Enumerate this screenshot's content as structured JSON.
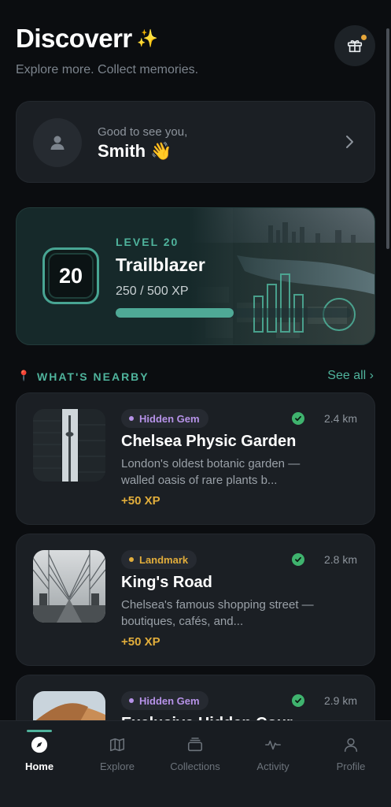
{
  "app": {
    "title": "Discoverr",
    "subtitle": "Explore more. Collect memories."
  },
  "greeting": {
    "prefix": "Good to see you,",
    "name": "Smith",
    "emoji": "👋"
  },
  "level": {
    "label": "LEVEL 20",
    "number": "20",
    "title": "Trailblazer",
    "xp_text": "250 / 500 XP",
    "progress": 0.5
  },
  "nearby": {
    "label": "WHAT'S NEARBY",
    "see_all": "See all ›"
  },
  "places": [
    {
      "tag": "Hidden Gem",
      "tag_color": "#b692e8",
      "distance": "2.4 km",
      "name": "Chelsea Physic Garden",
      "description": "London's oldest botanic garden — walled oasis of rare plants b...",
      "xp": "+50 XP",
      "icon": "tower-photo"
    },
    {
      "tag": "Landmark",
      "tag_color": "#e1ad3b",
      "distance": "2.8 km",
      "name": "King's Road",
      "description": "Chelsea's famous shopping street — boutiques, cafés, and...",
      "xp": "+50 XP",
      "icon": "bridge-photo"
    },
    {
      "tag": "Hidden Gem",
      "tag_color": "#b692e8",
      "distance": "2.9 km",
      "name": "Exclusive Hidden Cour...",
      "description": "",
      "xp": "",
      "icon": "dune-photo"
    }
  ],
  "tabs": [
    {
      "label": "Home",
      "icon": "compass-icon",
      "active": true
    },
    {
      "label": "Explore",
      "icon": "map-icon",
      "active": false
    },
    {
      "label": "Collections",
      "icon": "collections-icon",
      "active": false
    },
    {
      "label": "Activity",
      "icon": "activity-icon",
      "active": false
    },
    {
      "label": "Profile",
      "icon": "profile-icon",
      "active": false
    }
  ],
  "colors": {
    "accent": "#4fb39c",
    "xp": "#e1ad3b",
    "verified": "#3fb36e",
    "background": "#0b0d10"
  }
}
